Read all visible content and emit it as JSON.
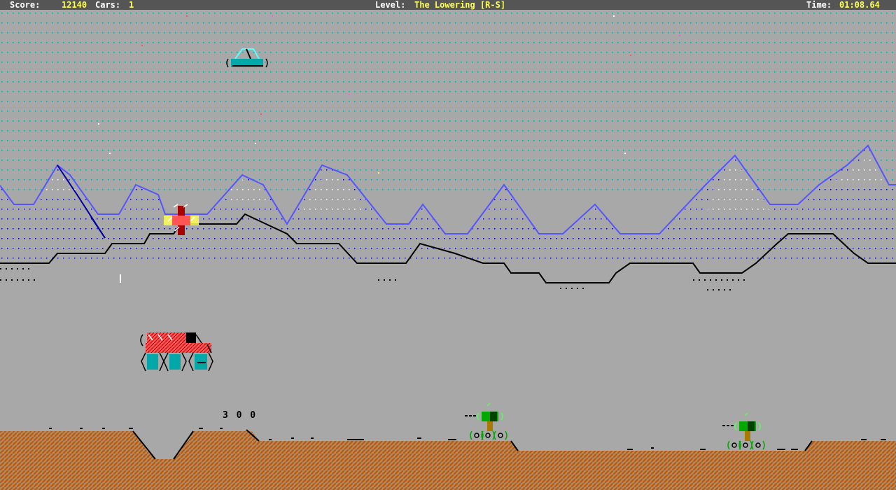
{
  "hud": {
    "score_label": "Score:",
    "score_value": "12140",
    "cars_label": "Cars:",
    "cars_value": "1",
    "level_label": "Level:",
    "level_name": "The Lowering [R-S]",
    "time_label": "Time:",
    "time_value": "01:08.64"
  },
  "popup": {
    "points": "3 0 0"
  },
  "colors": {
    "sky": "#a8a8a8",
    "hud_bg": "#555555",
    "hud_label": "#ffffff",
    "hud_value": "#ffff55",
    "star_dots": "#00a8a8",
    "mountain_line": "#5555ff",
    "mountain_shadow": "#0000a8",
    "ground": "#b56a2a",
    "player_body": "#ff5555",
    "player_wheels": "#00a8a8",
    "ufo": "#00a8a8",
    "tank": "#00a800"
  },
  "icons": {
    "player": "moon-buggy-icon",
    "ufo": "flying-saucer-icon",
    "tank": "ground-tank-icon",
    "explosion": "explosion-icon"
  }
}
